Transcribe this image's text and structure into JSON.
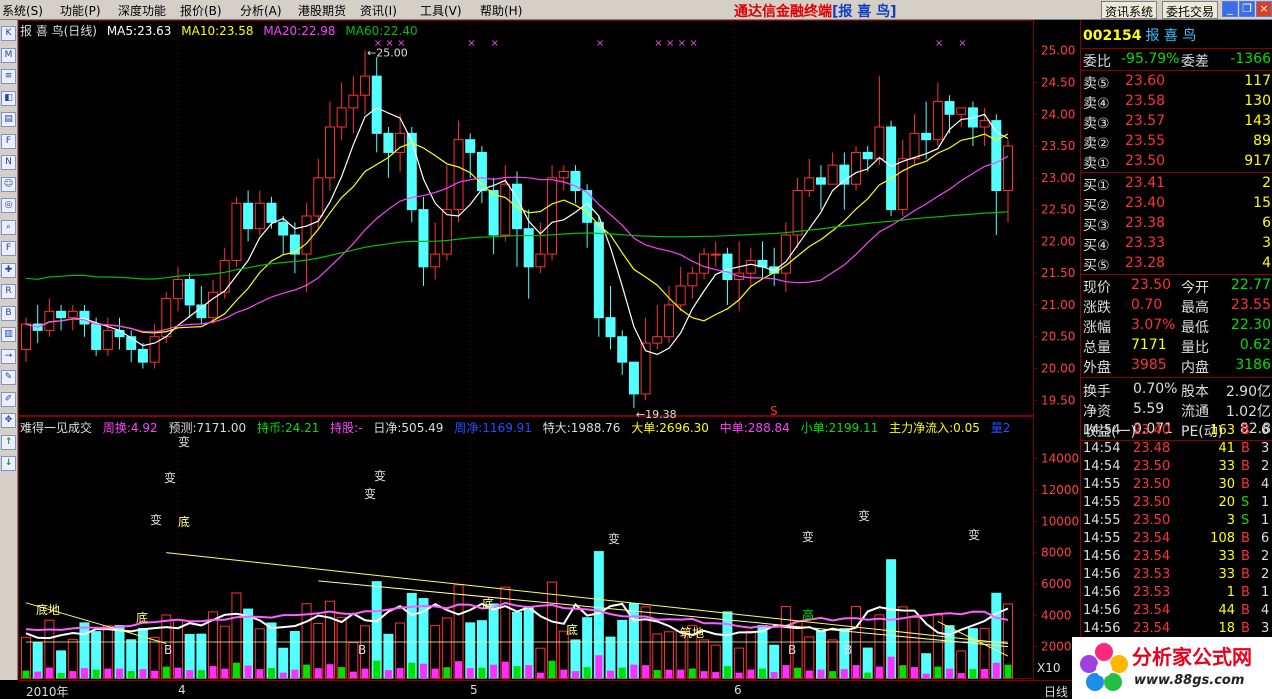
{
  "menu": {
    "items": [
      "系统(S)",
      "功能(P)",
      "深度功能",
      "报价(B)",
      "分析(A)",
      "港股期货",
      "资讯(I)",
      "工具(V)",
      "帮助(H)"
    ],
    "brand": "通达信金融终端",
    "brand_stock": "[报 喜 鸟]",
    "btn_news": "资讯系统",
    "btn_trade": "委托交易"
  },
  "toolbar_icons": [
    "k-chart-icon",
    "minute-chart-icon",
    "list-icon",
    "sector-icon",
    "report-icon",
    "f10-icon",
    "news-icon",
    "user-group-icon",
    "globe-icon",
    "search-icon",
    "f-icon",
    "cross-icon",
    "rsi-icon",
    "bsi-icon",
    "chart-icon",
    "arrow-right-icon",
    "note-icon",
    "pencil-icon",
    "move-icon",
    "up-arrow-icon",
    "down-arrow-icon"
  ],
  "main_legend": {
    "name": "报 喜 鸟(日线)",
    "ma5": "MA5:23.63",
    "ma10": "MA10:23.58",
    "ma20": "MA20:22.98",
    "ma60": "MA60:22.40"
  },
  "sub_legend": {
    "title": "难得一见成交",
    "zhouhuan": "周换:4.92",
    "yuce": "预测:7171.00",
    "chibi": "持币:24.21",
    "chigu": "持股:-",
    "rijing": "日净:505.49",
    "zhoujing": "周净:1169.91",
    "teda": "特大:1988.76",
    "dadan": "大单:2696.30",
    "zhongdan": "中单:288.84",
    "xiaodan": "小单:2199.11",
    "zhuli": "主力净流入:0.05",
    "liang": "量2"
  },
  "annotations": {
    "high": "25.00",
    "low": "19.38",
    "s_mark": "S",
    "bian": "变",
    "di": "底",
    "di_di": "底地",
    "gao": "高",
    "zhiti": "筑地",
    "b_mark": "B"
  },
  "price_axis": [
    "25.00",
    "24.50",
    "24.00",
    "23.50",
    "23.00",
    "22.50",
    "22.00",
    "21.50",
    "21.00",
    "20.50",
    "20.00",
    "19.50"
  ],
  "volume_axis": [
    "14000",
    "12000",
    "10000",
    "8000",
    "6000",
    "4000",
    "2000"
  ],
  "volume_axis_unit": "X10",
  "bottom": {
    "year": "2010年",
    "m4": "4",
    "m5": "5",
    "m6": "6",
    "period": "日线"
  },
  "quote": {
    "code": "002154",
    "name": "报 喜 鸟",
    "weibi_label": "委比",
    "weibi": "-95.79%",
    "weicha_label": "委差",
    "weicha": "-1366",
    "asks": [
      {
        "label": "卖⑤",
        "price": "23.60",
        "vol": "117"
      },
      {
        "label": "卖④",
        "price": "23.58",
        "vol": "130"
      },
      {
        "label": "卖③",
        "price": "23.57",
        "vol": "143"
      },
      {
        "label": "卖②",
        "price": "23.55",
        "vol": "89"
      },
      {
        "label": "卖①",
        "price": "23.50",
        "vol": "917"
      }
    ],
    "bids": [
      {
        "label": "买①",
        "price": "23.41",
        "vol": "2"
      },
      {
        "label": "买②",
        "price": "23.40",
        "vol": "15"
      },
      {
        "label": "买③",
        "price": "23.38",
        "vol": "6"
      },
      {
        "label": "买④",
        "price": "23.33",
        "vol": "3"
      },
      {
        "label": "买⑤",
        "price": "23.28",
        "vol": "4"
      }
    ],
    "stats": [
      {
        "l1": "现价",
        "v1": "23.50",
        "c1": "#ff3232",
        "l2": "今开",
        "v2": "22.77",
        "c2": "#00e000"
      },
      {
        "l1": "涨跌",
        "v1": "0.70",
        "c1": "#ff3232",
        "l2": "最高",
        "v2": "23.55",
        "c2": "#ff3232"
      },
      {
        "l1": "涨幅",
        "v1": "3.07%",
        "c1": "#ff3232",
        "l2": "最低",
        "v2": "22.30",
        "c2": "#00e000"
      },
      {
        "l1": "总量",
        "v1": "7171",
        "c1": "#ffff00",
        "l2": "量比",
        "v2": "0.62",
        "c2": "#00e000"
      },
      {
        "l1": "外盘",
        "v1": "3985",
        "c1": "#ff3232",
        "l2": "内盘",
        "v2": "3186",
        "c2": "#00e000"
      }
    ],
    "stats2": [
      {
        "l1": "换手",
        "v1": "0.70%",
        "l2": "股本",
        "v2": "2.90亿"
      },
      {
        "l1": "净资",
        "v1": "5.59",
        "l2": "流通",
        "v2": "1.02亿"
      },
      {
        "l1": "收益(一)",
        "v1": "0.071",
        "l2": "PE(动)",
        "v2": "82.8"
      }
    ],
    "ticks": [
      {
        "time": "14:54",
        "price": "23.40",
        "vol": "163",
        "bs": "B",
        "n": "6"
      },
      {
        "time": "14:54",
        "price": "23.48",
        "vol": "41",
        "bs": "B",
        "n": "3"
      },
      {
        "time": "14:54",
        "price": "23.50",
        "vol": "33",
        "bs": "B",
        "n": "2"
      },
      {
        "time": "14:55",
        "price": "23.50",
        "vol": "30",
        "bs": "B",
        "n": "4"
      },
      {
        "time": "14:55",
        "price": "23.50",
        "vol": "20",
        "bs": "S",
        "n": "1"
      },
      {
        "time": "14:55",
        "price": "23.50",
        "vol": "3",
        "bs": "S",
        "n": "1"
      },
      {
        "time": "14:55",
        "price": "23.54",
        "vol": "108",
        "bs": "B",
        "n": "6"
      },
      {
        "time": "14:56",
        "price": "23.54",
        "vol": "33",
        "bs": "B",
        "n": "2"
      },
      {
        "time": "14:56",
        "price": "23.53",
        "vol": "33",
        "bs": "B",
        "n": "2"
      },
      {
        "time": "14:56",
        "price": "23.53",
        "vol": "1",
        "bs": "B",
        "n": "1"
      },
      {
        "time": "14:56",
        "price": "23.54",
        "vol": "44",
        "bs": "B",
        "n": "4"
      },
      {
        "time": "14:56",
        "price": "23.54",
        "vol": "18",
        "bs": "B",
        "n": "3"
      }
    ]
  },
  "watermark": {
    "title": "分析家公式网",
    "url": "www.88gs.com"
  },
  "colors": {
    "up": "#ff3232",
    "down": "#54ffff",
    "ma5": "#ffffff",
    "ma10": "#ffff00",
    "ma20": "#ff40ff",
    "ma60": "#00c000",
    "frame": "#800000"
  },
  "chart_data": {
    "type": "candlestick",
    "title": "报 喜 鸟(日线)",
    "ylim": [
      19.3,
      25.2
    ],
    "candles": [
      [
        20.3,
        20.7,
        20.1,
        20.8
      ],
      [
        20.7,
        20.6,
        20.4,
        21.0
      ],
      [
        20.6,
        20.9,
        20.5,
        21.1
      ],
      [
        20.9,
        20.8,
        20.6,
        21.0
      ],
      [
        20.8,
        20.9,
        20.6,
        21.0
      ],
      [
        20.9,
        20.7,
        20.5,
        21.0
      ],
      [
        20.7,
        20.3,
        20.2,
        20.8
      ],
      [
        20.3,
        20.6,
        20.2,
        20.8
      ],
      [
        20.6,
        20.5,
        20.3,
        20.8
      ],
      [
        20.5,
        20.3,
        20.1,
        20.6
      ],
      [
        20.3,
        20.1,
        20.0,
        20.4
      ],
      [
        20.1,
        20.5,
        20.0,
        20.7
      ],
      [
        20.5,
        21.1,
        20.4,
        21.2
      ],
      [
        21.1,
        21.4,
        20.9,
        21.6
      ],
      [
        21.4,
        21.0,
        20.8,
        21.5
      ],
      [
        21.0,
        20.8,
        20.7,
        21.3
      ],
      [
        20.8,
        21.2,
        20.7,
        21.4
      ],
      [
        21.2,
        21.7,
        21.1,
        21.9
      ],
      [
        21.7,
        22.6,
        21.6,
        22.7
      ],
      [
        22.6,
        22.2,
        22.0,
        22.8
      ],
      [
        22.2,
        22.6,
        22.1,
        22.8
      ],
      [
        22.6,
        22.3,
        22.2,
        22.7
      ],
      [
        22.3,
        22.1,
        21.8,
        22.4
      ],
      [
        22.1,
        21.8,
        21.5,
        22.3
      ],
      [
        21.8,
        22.4,
        21.2,
        22.6
      ],
      [
        22.4,
        23.0,
        22.2,
        23.3
      ],
      [
        23.0,
        23.8,
        22.8,
        24.2
      ],
      [
        23.8,
        24.1,
        23.6,
        24.5
      ],
      [
        24.1,
        24.3,
        23.7,
        24.6
      ],
      [
        24.3,
        24.6,
        24.0,
        25.0
      ],
      [
        24.6,
        23.7,
        23.4,
        24.9
      ],
      [
        23.7,
        23.4,
        23.0,
        23.8
      ],
      [
        23.4,
        23.7,
        23.1,
        24.0
      ],
      [
        23.7,
        22.5,
        22.3,
        23.8
      ],
      [
        22.5,
        21.6,
        21.3,
        22.7
      ],
      [
        21.6,
        21.8,
        21.4,
        22.3
      ],
      [
        21.8,
        22.5,
        21.7,
        23.2
      ],
      [
        22.5,
        23.6,
        22.3,
        23.9
      ],
      [
        23.6,
        23.4,
        23.0,
        23.7
      ],
      [
        23.4,
        22.8,
        22.6,
        23.5
      ],
      [
        22.8,
        22.1,
        21.8,
        23.0
      ],
      [
        22.1,
        22.9,
        22.0,
        23.2
      ],
      [
        22.9,
        22.2,
        21.6,
        23.1
      ],
      [
        22.2,
        21.6,
        21.1,
        22.5
      ],
      [
        21.6,
        21.8,
        21.5,
        22.3
      ],
      [
        21.8,
        23.0,
        21.7,
        23.2
      ],
      [
        23.0,
        23.1,
        22.8,
        23.2
      ],
      [
        23.1,
        22.8,
        22.6,
        23.2
      ],
      [
        22.8,
        22.3,
        21.9,
        22.9
      ],
      [
        22.3,
        20.8,
        20.5,
        22.4
      ],
      [
        20.8,
        20.5,
        20.3,
        21.3
      ],
      [
        20.5,
        20.1,
        19.9,
        20.6
      ],
      [
        20.1,
        19.6,
        19.38,
        20.1
      ],
      [
        19.6,
        20.4,
        19.5,
        20.8
      ],
      [
        20.4,
        20.5,
        20.3,
        21.0
      ],
      [
        20.5,
        21.0,
        20.4,
        21.3
      ],
      [
        21.0,
        21.3,
        20.9,
        21.6
      ],
      [
        21.3,
        21.5,
        21.1,
        21.6
      ],
      [
        21.5,
        21.8,
        21.4,
        21.9
      ],
      [
        21.8,
        21.8,
        21.6,
        22.0
      ],
      [
        21.8,
        21.4,
        21.0,
        21.9
      ],
      [
        21.4,
        21.5,
        20.9,
        22.0
      ],
      [
        21.5,
        21.7,
        21.3,
        21.9
      ],
      [
        21.7,
        21.6,
        21.4,
        22.0
      ],
      [
        21.6,
        21.5,
        21.3,
        21.9
      ],
      [
        21.5,
        22.1,
        21.2,
        22.3
      ],
      [
        22.1,
        22.8,
        21.9,
        23.0
      ],
      [
        22.8,
        23.0,
        22.7,
        23.3
      ],
      [
        23.0,
        22.9,
        22.5,
        23.2
      ],
      [
        22.9,
        23.2,
        22.9,
        23.4
      ],
      [
        23.2,
        22.9,
        22.5,
        23.4
      ],
      [
        22.9,
        23.4,
        22.8,
        23.5
      ],
      [
        23.4,
        23.3,
        23.1,
        23.5
      ],
      [
        23.3,
        23.8,
        23.2,
        24.6
      ],
      [
        23.8,
        22.5,
        22.4,
        23.9
      ],
      [
        22.5,
        23.3,
        22.4,
        23.6
      ],
      [
        23.3,
        23.7,
        23.2,
        24.0
      ],
      [
        23.7,
        23.6,
        23.3,
        24.2
      ],
      [
        23.6,
        24.2,
        23.5,
        24.5
      ],
      [
        24.2,
        24.0,
        23.7,
        24.3
      ],
      [
        24.0,
        24.1,
        23.8,
        24.1
      ],
      [
        24.1,
        23.8,
        23.5,
        24.2
      ],
      [
        23.8,
        23.9,
        23.5,
        24.1
      ],
      [
        23.9,
        22.8,
        22.1,
        24.0
      ],
      [
        22.8,
        23.5,
        22.3,
        23.6
      ]
    ]
  }
}
